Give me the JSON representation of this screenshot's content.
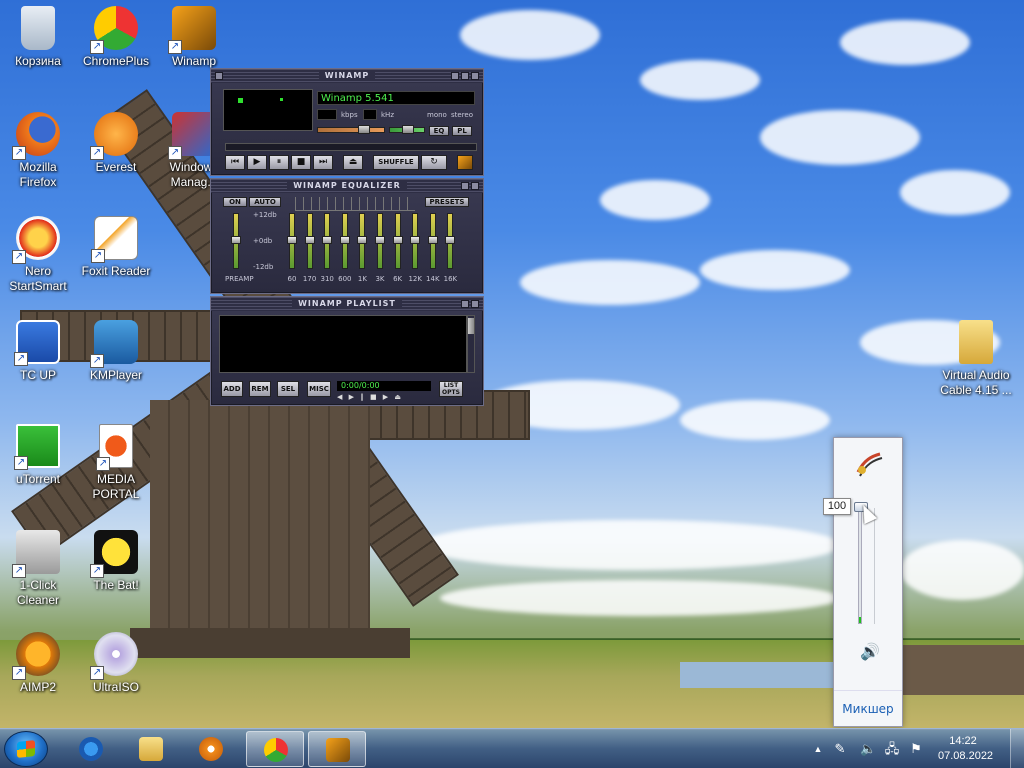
{
  "desktop": {
    "icons": [
      {
        "label": "Корзина",
        "icon": "recycle-bin-icon"
      },
      {
        "label": "ChromePlus",
        "icon": "chromeplus-icon"
      },
      {
        "label": "Winamp",
        "icon": "winamp-icon"
      },
      {
        "label": "Mozilla\nFirefox",
        "icon": "firefox-icon"
      },
      {
        "label": "Everest",
        "icon": "everest-icon"
      },
      {
        "label": "Windows\nManag...",
        "icon": "windows-manager-icon"
      },
      {
        "label": "Nero\nStartSmart",
        "icon": "nero-icon"
      },
      {
        "label": "Foxit Reader",
        "icon": "foxit-reader-icon"
      },
      {
        "label": "TC UP",
        "icon": "total-commander-icon"
      },
      {
        "label": "KMPlayer",
        "icon": "kmplayer-icon"
      },
      {
        "label": "uTorrent",
        "icon": "utorrent-icon"
      },
      {
        "label": "MEDIA\nPORTAL",
        "icon": "mediaportal-icon"
      },
      {
        "label": "1-Click\nCleaner",
        "icon": "cleaner-icon"
      },
      {
        "label": "The Bat!",
        "icon": "the-bat-icon"
      },
      {
        "label": "AIMP2",
        "icon": "aimp-icon"
      },
      {
        "label": "UltraISO",
        "icon": "ultraiso-icon"
      },
      {
        "label": "Virtual Audio\nCable 4.15 ...",
        "icon": "folder-icon"
      }
    ]
  },
  "winamp": {
    "main_title": "WINAMP",
    "track_display": "Winamp 5.541",
    "kbps_label": "kbps",
    "khz_label": "kHz",
    "mono_label": "mono",
    "stereo_label": "stereo",
    "eq_btn": "EQ",
    "pl_btn": "PL",
    "shuffle_btn": "SHUFFLE",
    "equalizer_title": "WINAMP EQUALIZER",
    "eq_on": "ON",
    "eq_auto": "AUTO",
    "eq_presets": "PRESETS",
    "eq_db_top": "+12db",
    "eq_db_mid": "+0db",
    "eq_db_bot": "-12db",
    "eq_preamp": "PREAMP",
    "eq_freqs": [
      "60",
      "170",
      "310",
      "600",
      "1K",
      "3K",
      "6K",
      "12K",
      "14K",
      "16K"
    ],
    "playlist_title": "WINAMP PLAYLIST",
    "pl_add": "ADD",
    "pl_rem": "REM",
    "pl_sel": "SEL",
    "pl_misc": "MISC",
    "pl_time": "0:00/0:00",
    "pl_list_opts": "LIST\nOPTS"
  },
  "volume": {
    "level_tooltip": "100",
    "level": 100,
    "mixer_link": "Микшер"
  },
  "taskbar": {
    "time": "14:22",
    "date": "07.08.2022"
  }
}
